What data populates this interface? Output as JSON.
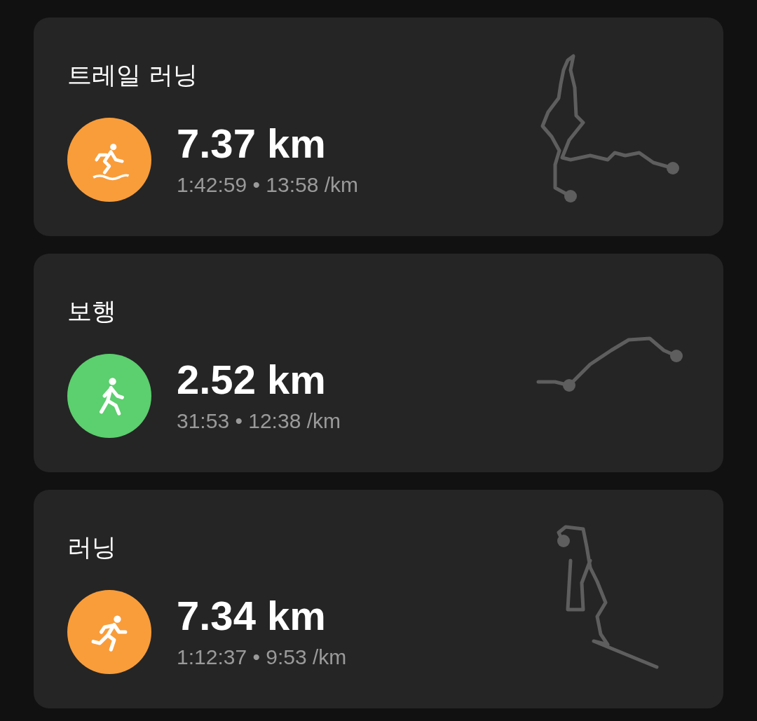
{
  "activities": [
    {
      "title": "트레일 러닝",
      "kind": "trail_running",
      "color": "#f99d3a",
      "distance": "7.37 km",
      "summary": "1:42:59 • 13:58 /km"
    },
    {
      "title": "보행",
      "kind": "walking",
      "color": "#5ccf6e",
      "distance": "2.52 km",
      "summary": "31:53 • 12:38 /km"
    },
    {
      "title": "러닝",
      "kind": "running",
      "color": "#f99d3a",
      "distance": "7.34 km",
      "summary": "1:12:37 • 9:53 /km"
    }
  ]
}
